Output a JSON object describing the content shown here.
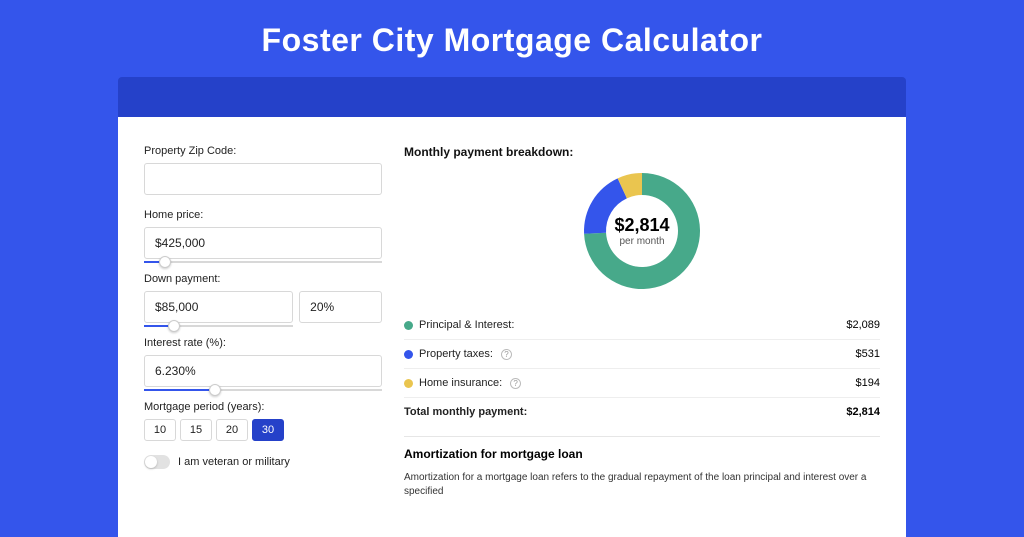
{
  "hero_title": "Foster City Mortgage Calculator",
  "left": {
    "zip_label": "Property Zip Code:",
    "zip_value": "",
    "price_label": "Home price:",
    "price_value": "$425,000",
    "price_slider_pct": 9,
    "down_label": "Down payment:",
    "down_value": "$85,000",
    "down_pct_value": "20%",
    "down_slider_pct": 20,
    "rate_label": "Interest rate (%):",
    "rate_value": "6.230%",
    "rate_slider_pct": 30,
    "period_label": "Mortgage period (years):",
    "periods": [
      "10",
      "15",
      "20",
      "30"
    ],
    "period_selected": "30",
    "veteran_label": "I am veteran or military"
  },
  "right": {
    "breakdown_title": "Monthly payment breakdown:",
    "center_amount": "$2,814",
    "center_sub": "per month",
    "items": [
      {
        "label": "Principal & Interest:",
        "value": "$2,089",
        "help": false,
        "numeric": 2089
      },
      {
        "label": "Property taxes:",
        "value": "$531",
        "help": true,
        "numeric": 531
      },
      {
        "label": "Home insurance:",
        "value": "$194",
        "help": true,
        "numeric": 194
      }
    ],
    "total_label": "Total monthly payment:",
    "total_value": "$2,814",
    "amort_title": "Amortization for mortgage loan",
    "amort_text": "Amortization for a mortgage loan refers to the gradual repayment of the loan principal and interest over a specified"
  },
  "chart_data": {
    "type": "pie",
    "title": "Monthly payment breakdown",
    "series": [
      {
        "name": "Principal & Interest",
        "value": 2089,
        "color": "#47a98a"
      },
      {
        "name": "Property taxes",
        "value": 531,
        "color": "#3455eb"
      },
      {
        "name": "Home insurance",
        "value": 194,
        "color": "#eac54f"
      }
    ],
    "total": 2814,
    "center_label": "$2,814 per month"
  }
}
